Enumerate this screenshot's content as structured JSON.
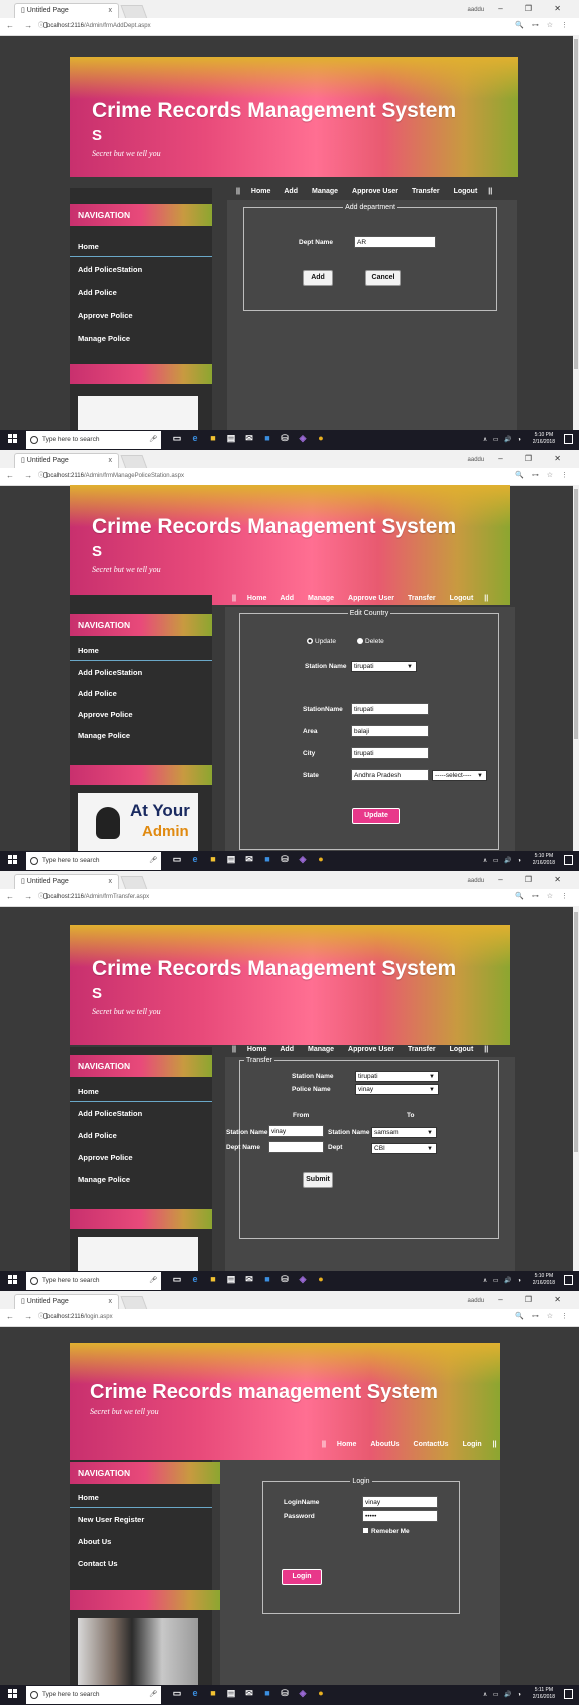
{
  "browser": {
    "tab_title": "Untitled Page",
    "tab_close": "x",
    "user": "aaddu",
    "window_controls": "–  ❐  ✕",
    "nav_buttons": "← → C",
    "secure_icon": "ⓘ",
    "addr_icons": "🔍 ⊶ ☆ ⋮"
  },
  "taskbar": {
    "search_placeholder": "Type here to search",
    "tray": "∧ ▭ 🔊 ◑",
    "time": "5:10 PM",
    "time_last": "5:11 PM",
    "date": "2/16/2018"
  },
  "site": {
    "tagline": "Secret but we tell you",
    "nav_heading": "NAVIGATION"
  },
  "screen1": {
    "url_domain": "localhost:2116",
    "url_path": "/Admin/frmAddDept.aspx",
    "title": "Crime Records Management System",
    "title_s": "S",
    "sidebar": [
      "Home",
      "Add PoliceStation",
      "Add Police",
      "Approve Police",
      "Manage Police"
    ],
    "menu": [
      "Home",
      "Add",
      "Manage",
      "Approve User",
      "Transfer",
      "Logout"
    ],
    "legend": "Add department",
    "dept_label": "Dept Name",
    "dept_value": "AR",
    "add_button": "Add",
    "cancel_button": "Cancel"
  },
  "screen2": {
    "url_domain": "localhost:2116",
    "url_path": "/Admin/frmManagePoliceStation.aspx",
    "title": "Crime Records Management System",
    "title_s": "S",
    "sidebar": [
      "Home",
      "Add PoliceStation",
      "Add Police",
      "Approve Police",
      "Manage Police"
    ],
    "menu": [
      "Home",
      "Add",
      "Manage",
      "Approve User",
      "Transfer",
      "Logout"
    ],
    "legend": "Edit Country",
    "radio_update": "Update",
    "radio_delete": "Delete",
    "station_name_label": "Station Name",
    "station_select": "tirupati",
    "fields": [
      {
        "label": "StationName",
        "value": "tirupati"
      },
      {
        "label": "Area",
        "value": "balaji"
      },
      {
        "label": "City",
        "value": "tirupati"
      },
      {
        "label": "State",
        "value": "Andhra Pradesh"
      }
    ],
    "state_select": "-----select----",
    "update_button": "Update",
    "ad_text": "At Your",
    "ad_text2": "Admin"
  },
  "screen3": {
    "url_domain": "localhost:2116",
    "url_path": "/Admin/frmTransfer.aspx",
    "title": "Crime Records Management System",
    "title_s": "S",
    "sidebar": [
      "Home",
      "Add PoliceStation",
      "Add Police",
      "Approve Police",
      "Manage Police"
    ],
    "menu": [
      "Home",
      "Add",
      "Manage",
      "Approve User",
      "Transfer",
      "Logout"
    ],
    "legend": "Transfer",
    "station_name_label": "Station Name",
    "station_name_value": "tirupati",
    "police_name_label": "Police Name",
    "police_name_value": "vinay",
    "from_label": "From",
    "to_label": "To",
    "from_station_label": "Station Name",
    "from_station_value": "vinay",
    "to_station_label": "Station Name",
    "to_station_value": "samsam",
    "dept_name_label": "Dept Name",
    "dept_name_value": "",
    "dept_label": "Dept",
    "dept_value": "CBI",
    "submit_button": "Submit"
  },
  "screen4": {
    "url_domain": "localhost:2116",
    "url_path": "/login.aspx",
    "title": "Crime Records management System",
    "sidebar": [
      "Home",
      "New User Register",
      "About Us",
      "Contact Us"
    ],
    "menu": [
      "Home",
      "AboutUs",
      "ContactUs",
      "Login"
    ],
    "legend": "Login",
    "login_name_label": "LoginName",
    "login_name_value": "vinay",
    "password_label": "Password",
    "password_value": "•••••",
    "remember_label": "Remeber Me",
    "login_button": "Login"
  }
}
